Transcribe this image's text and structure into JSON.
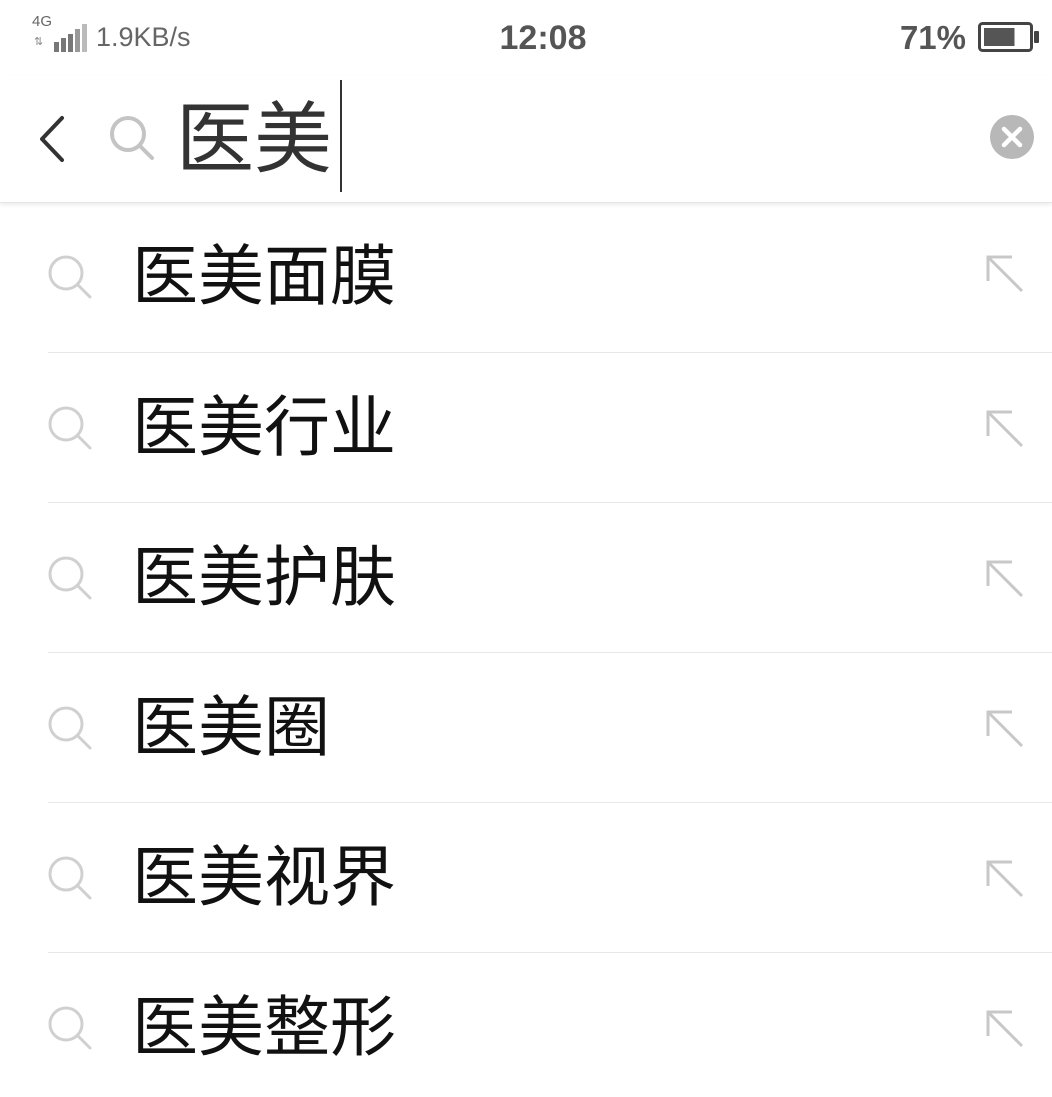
{
  "status_bar": {
    "network_type": "4G",
    "network_arrows": "⇅",
    "network_speed": "1.9KB/s",
    "time": "12:08",
    "battery_percent": "71%",
    "battery_level": 0.71,
    "signal_icon": "signal-bars-icon",
    "battery_icon": "battery-icon"
  },
  "search": {
    "query": "医美",
    "back_icon": "chevron-left-icon",
    "search_icon": "search-icon",
    "clear_icon": "clear-circle-icon"
  },
  "suggestions": [
    {
      "text": "医美面膜"
    },
    {
      "text": "医美行业"
    },
    {
      "text": "医美护肤"
    },
    {
      "text": "医美圈"
    },
    {
      "text": "医美视界"
    },
    {
      "text": "医美整形"
    }
  ],
  "suggestion_icons": {
    "left": "search-icon",
    "right": "arrow-up-left-icon"
  },
  "colors": {
    "text_primary": "#111111",
    "icon_gray": "#c8c8c8",
    "divider": "#e8e8e8",
    "clear_button": "#b8b8b8"
  }
}
